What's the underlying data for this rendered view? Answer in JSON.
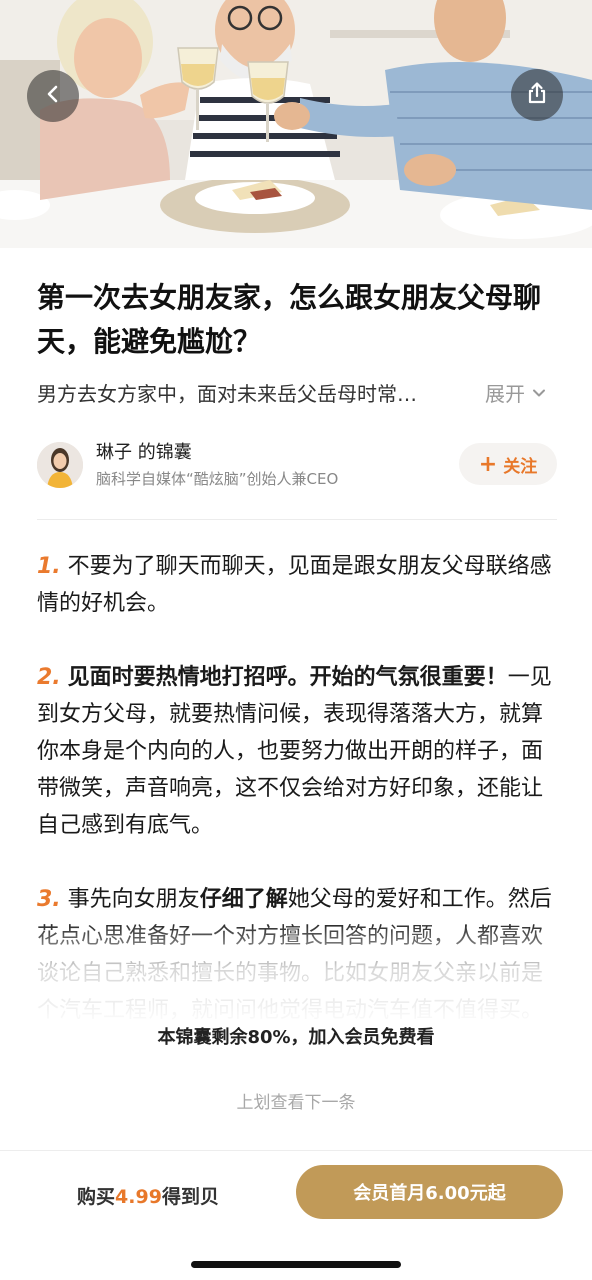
{
  "hero": {
    "image": "dinner-toast-photo"
  },
  "nav": {
    "back_icon": "chevron-left-icon",
    "share_icon": "share-icon"
  },
  "article": {
    "title": "第一次去女朋友家，怎么跟女朋友父母聊天，能避免尴尬？",
    "summary": "男方去女方家中，面对未来岳父岳母时常…",
    "expand_label": "展开"
  },
  "author": {
    "name": "琳子 的锦囊",
    "description": "脑科学自媒体“酷炫脑”创始人兼CEO",
    "follow_label": "关注",
    "follow_plus": "+"
  },
  "content": {
    "items": [
      {
        "number": "1.",
        "text": "不要为了聊天而聊天，见面是跟女朋友父母联络感情的好机会。"
      },
      {
        "number": "2.",
        "bold": "见面时要热情地打招呼。开始的气氛很重要！",
        "text": "一见到女方父母，就要热情问候，表现得落落大方，就算你本身是个内向的人，也要努力做出开朗的样子，面带微笑，声音响亮，这不仅会给对方好印象，还能让自己感到有底气。"
      },
      {
        "number": "3.",
        "pre": "事先向女朋友",
        "bold": "仔细了解",
        "post": "她父母的爱好和工作。然后花点心思准备好一个对方擅长回答的问题，人都喜欢谈论自己熟悉和擅长的事物。比如女朋友父亲以前是个汽车工程师，就问问他觉得电动汽车值不值得买。"
      }
    ]
  },
  "paywall": {
    "note": "本锦囊剩余80%，加入会员免费看",
    "next_hint": "上划查看下一条"
  },
  "bottom_bar": {
    "buy_prefix": "购买",
    "buy_price": "4.99",
    "buy_suffix": "得到贝",
    "member_label": "会员首月6.00元起"
  },
  "colors": {
    "accent": "#e8782a",
    "gold": "#c19a58"
  }
}
